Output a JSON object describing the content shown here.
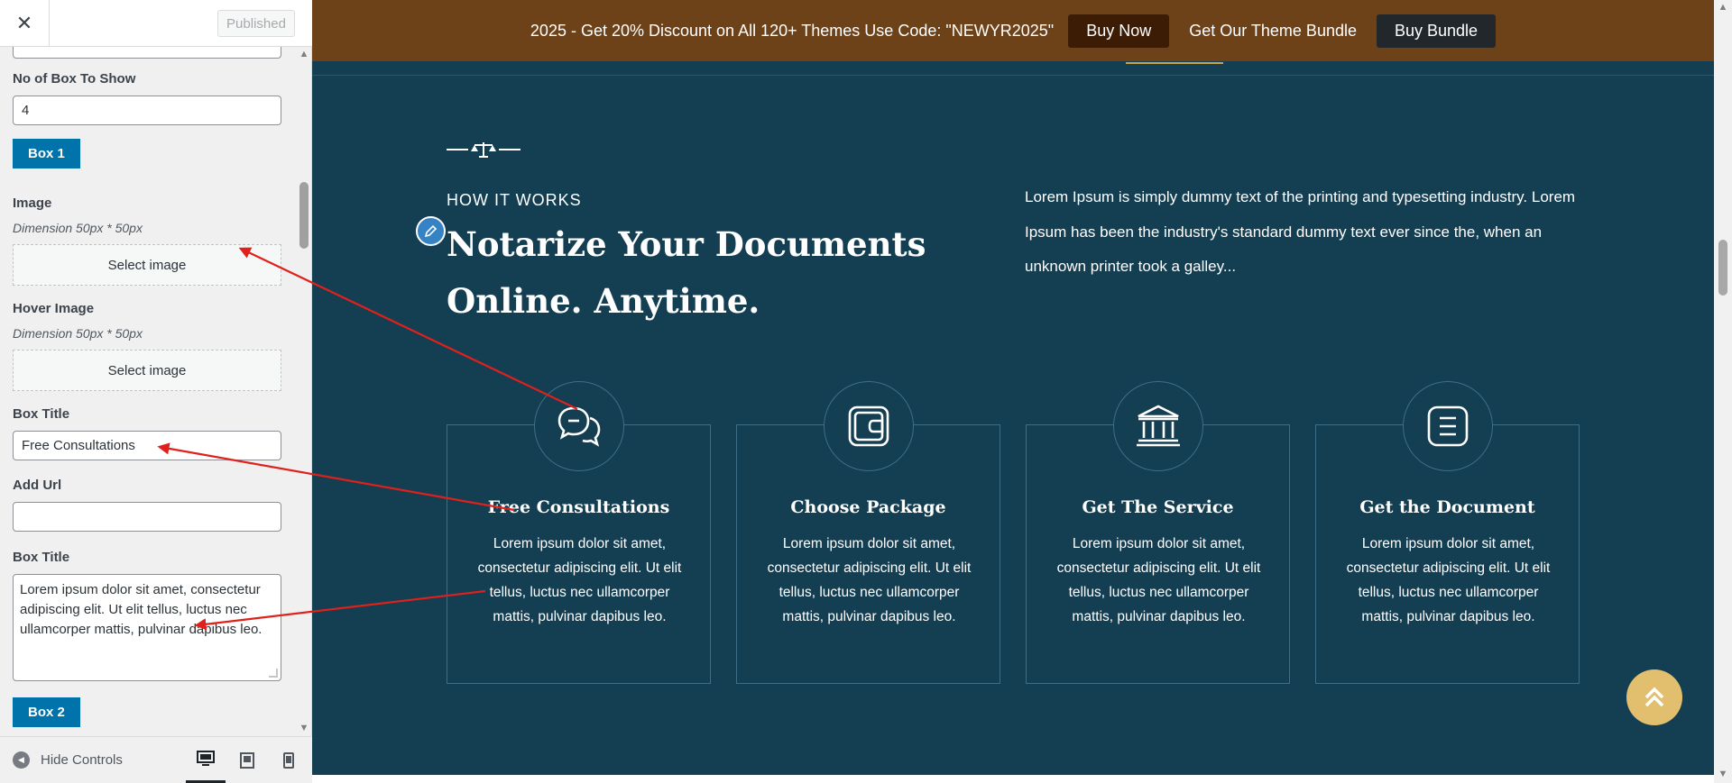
{
  "header": {
    "close_icon": "close-icon",
    "published_label": "Published"
  },
  "sidebar": {
    "box_count_label": "No of Box To Show",
    "box_count_value": "4",
    "box1_label": "Box 1",
    "image_label": "Image",
    "image_dimension": "Dimension 50px * 50px",
    "select_image_label": "Select image",
    "hover_image_label": "Hover Image",
    "hover_dimension": "Dimension 50px * 50px",
    "select_hover_label": "Select image",
    "box_title_label": "Box Title",
    "box_title_value": "Free Consultations",
    "add_url_label": "Add Url",
    "add_url_value": "",
    "box_desc_label": "Box Title",
    "box_desc_value": "Lorem ipsum dolor sit amet, consectetur adipiscing elit. Ut elit tellus, luctus nec ullamcorper mattis, pulvinar dapibus leo.",
    "box2_label": "Box 2"
  },
  "footer": {
    "hide_controls_label": "Hide Controls"
  },
  "promo": {
    "text": "2025 - Get 20% Discount on All 120+ Themes Use Code: \"NEWYR2025\"",
    "buy_now": "Buy Now",
    "bundle_link": "Get Our Theme Bundle",
    "buy_bundle": "Buy Bundle"
  },
  "section": {
    "eyebrow": "HOW IT WORKS",
    "title": "Notarize Your Documents Online. Anytime.",
    "intro": "Lorem Ipsum is simply dummy text of the printing and typesetting industry. Lorem Ipsum has been the industry's standard dummy text ever since the, when an unknown printer took a galley..."
  },
  "cards": [
    {
      "title": "Free Consultations",
      "desc": "Lorem ipsum dolor sit amet, consectetur adipiscing elit. Ut elit tellus, luctus nec ullamcorper mattis, pulvinar dapibus leo.",
      "icon": "chat-bubbles-icon"
    },
    {
      "title": "Choose Package",
      "desc": "Lorem ipsum dolor sit amet, consectetur adipiscing elit. Ut elit tellus, luctus nec ullamcorper mattis, pulvinar dapibus leo.",
      "icon": "wallet-icon"
    },
    {
      "title": "Get The Service",
      "desc": "Lorem ipsum dolor sit amet, consectetur adipiscing elit. Ut elit tellus, luctus nec ullamcorper mattis, pulvinar dapibus leo.",
      "icon": "bank-icon"
    },
    {
      "title": "Get the Document",
      "desc": "Lorem ipsum dolor sit amet, consectetur adipiscing elit. Ut elit tellus, luctus nec ullamcorper mattis, pulvinar dapibus leo.",
      "icon": "document-icon"
    }
  ],
  "colors": {
    "section_bg": "#143e52",
    "promo_bg": "#6e4219",
    "accent_gold": "#e2bf6f",
    "customizer_blue": "#0073aa",
    "annotation_red": "#e0201b"
  }
}
